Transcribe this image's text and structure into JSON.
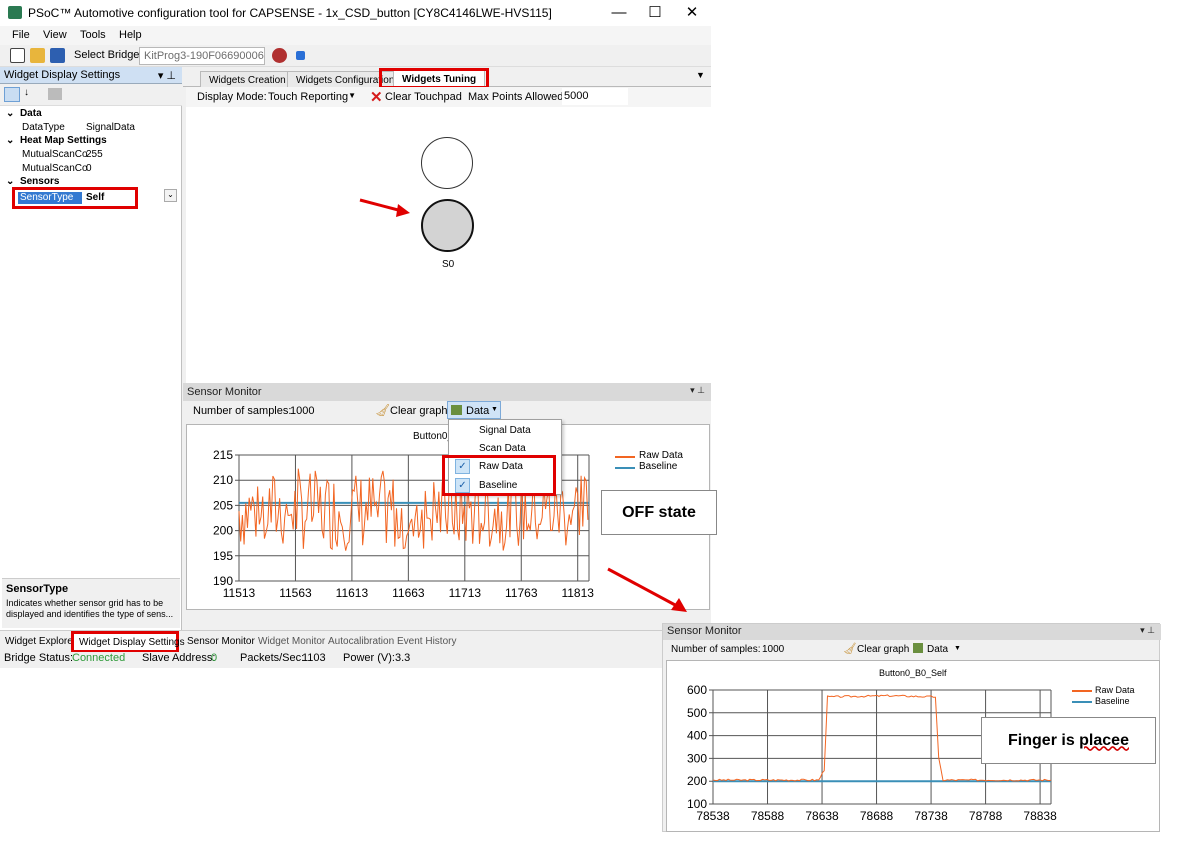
{
  "window": {
    "title": "PSoC™ Automotive configuration tool for CAPSENSE - 1x_CSD_button [CY8C4146LWE-HVS115]",
    "minimize": "—",
    "maximize": "☐",
    "close": "✕"
  },
  "menu": [
    "File",
    "View",
    "Tools",
    "Help"
  ],
  "toolbar": {
    "select_bridge_label": "Select Bridge:",
    "bridge_value": "KitProg3-190F066900062"
  },
  "left_panel": {
    "title": "Widget Display Settings",
    "pin": "▾ ⊥",
    "categories": [
      {
        "name": "Data",
        "props": [
          {
            "key": "DataType",
            "value": "SignalData"
          }
        ]
      },
      {
        "name": "Heat Map Settings",
        "props": [
          {
            "key": "MutualScanCo",
            "value": "255"
          },
          {
            "key": "MutualScanCo",
            "value": "0"
          }
        ]
      },
      {
        "name": "Sensors",
        "props": [
          {
            "key": "SensorType",
            "value": "Self"
          }
        ]
      }
    ],
    "help_title": "SensorType",
    "help_text_1": "Indicates whether sensor grid has to be",
    "help_text_2": "displayed and identifies the type of sens..."
  },
  "tabs": [
    "Widgets Creation",
    "Widgets Configuration",
    "Widgets Tuning"
  ],
  "tuning": {
    "display_mode_label": "Display Mode:",
    "display_mode_value": "Touch Reporting",
    "clear_touchpad": "Clear Touchpad",
    "max_points_label": "Max Points Allowed:",
    "max_points_value": "5000",
    "sensor_label": "S0"
  },
  "sensor_monitor": {
    "title": "Sensor Monitor",
    "samples_label": "Number of samples:",
    "samples_value": "1000",
    "clear_graph": "Clear graph",
    "data_button": "Data",
    "chart_title": "Button0_B0_Self",
    "menu_items": [
      {
        "label": "Signal Data",
        "checked": false
      },
      {
        "label": "Scan Data",
        "checked": false
      },
      {
        "label": "Raw Data",
        "checked": true
      },
      {
        "label": "Baseline",
        "checked": true
      }
    ]
  },
  "bottom_tabs_left": [
    "Widget Explorer",
    "Widget Display Settings"
  ],
  "bottom_tabs_right": [
    "Sensor Monitor",
    "Widget Monitor",
    "Autocalibration",
    "Event History"
  ],
  "status": {
    "bridge_label": "Bridge Status:",
    "bridge_value": "Connected",
    "slave_label": "Slave Address:",
    "slave_value": "0",
    "packets_label": "Packets/Sec:",
    "packets_value": "1103",
    "power_label": "Power (V):",
    "power_value": "3.3"
  },
  "callouts": {
    "off_state": "OFF state",
    "finger_prefix": "Finger is ",
    "finger_suffix": "placee"
  },
  "colors": {
    "raw": "#f26522",
    "baseline": "#3a8fb7",
    "highlight": "#e00000"
  },
  "chart_data": [
    {
      "type": "line",
      "title": "Button0_",
      "x_ticks": [
        11513,
        11563,
        11613,
        11663,
        11713,
        11763,
        11813
      ],
      "xlim": [
        11513,
        11823
      ],
      "y_ticks": [
        190,
        195,
        200,
        205,
        210,
        215
      ],
      "ylim": [
        190,
        215
      ],
      "series": [
        {
          "name": "Raw Data",
          "color": "#f26522",
          "description_points": "noisy signal oscillating between ~196 and ~212 around 205"
        },
        {
          "name": "Baseline",
          "color": "#3a8fb7",
          "values_constant": 205.5
        }
      ],
      "legend_position": "right"
    },
    {
      "type": "line",
      "title": "Button0_B0_Self",
      "x_ticks": [
        78538,
        78588,
        78638,
        78688,
        78738,
        78788,
        78838
      ],
      "xlim": [
        78538,
        78848
      ],
      "y_ticks": [
        100,
        200,
        300,
        400,
        500,
        600
      ],
      "ylim": [
        100,
        600
      ],
      "series": [
        {
          "name": "Raw Data",
          "color": "#f26522",
          "points": [
            [
              78538,
              205
            ],
            [
              78635,
              205
            ],
            [
              78640,
              250
            ],
            [
              78643,
              570
            ],
            [
              78700,
              575
            ],
            [
              78742,
              570
            ],
            [
              78745,
              300
            ],
            [
              78749,
              205
            ],
            [
              78848,
              205
            ]
          ]
        },
        {
          "name": "Baseline",
          "color": "#3a8fb7",
          "values_constant": 200
        }
      ],
      "legend_position": "right"
    }
  ]
}
